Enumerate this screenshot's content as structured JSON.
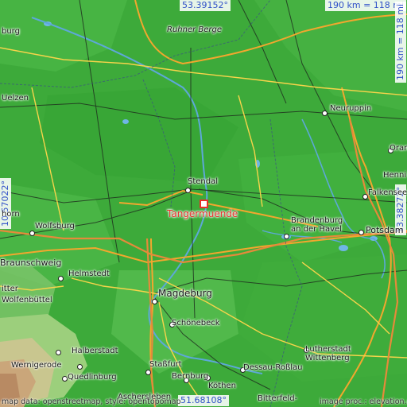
{
  "map": {
    "target": "Tangermuende",
    "coords": {
      "top": "53.39152°",
      "bottom": "51.68108°",
      "left": "10.57022°",
      "right": "13.38272°"
    },
    "scale": {
      "horizontal": "190 km = 118 mi",
      "vertical": "190 km = 118 mi"
    },
    "credit_left": "map data: openstreetmap, style: opentopomap",
    "credit_right": "image proc.: elevation.city",
    "places": {
      "ruhner_berge": "Ruhner Berge",
      "neuruppin": "Neuruppin",
      "uelzen": "Uelzen",
      "stendal": "Stendal",
      "wolfsburg": "Wolfsburg",
      "brandenburg": "Brandenburg",
      "brandenburg2": "an der Havel",
      "potsdam": "Potsdam",
      "braunschweig": "Braunschweig",
      "helmstedt": "Helmstedt",
      "magdeburg": "Magdeburg",
      "schoenebeck": "Schönebeck",
      "halberstadt": "Halberstadt",
      "wernigerode": "Wernigerode",
      "quedlinburg": "Quedlinburg",
      "aschersleben": "Aschersleben",
      "stassfurt": "Staßfurt",
      "bernburg": "Bernburg",
      "koethen": "Köthen",
      "dessau": "Dessau-Roßlau",
      "lutherstadt": "Lutherstadt",
      "wittenberg": "Wittenberg",
      "bitterfeld": "Bitterfeld-",
      "falkensee": "Falkensee",
      "henni": "Henni",
      "oran": "Oran",
      "burg": "burg",
      "horn": "horn",
      "itter": "itter",
      "wolfenbuettel": "Wolfenbüttel",
      "gifhorn_n": "Gifhorn"
    }
  }
}
